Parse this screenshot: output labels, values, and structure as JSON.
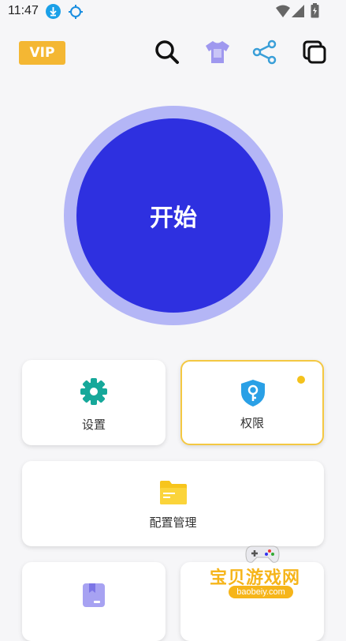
{
  "status_bar": {
    "time": "11:47"
  },
  "header": {
    "vip_label": "VIP",
    "icons": [
      "search-icon",
      "shirt-icon",
      "share-icon",
      "copy-icon"
    ]
  },
  "start": {
    "label": "开始",
    "accent": "#2e30e0",
    "ring": "#b4b6f6"
  },
  "cards": {
    "settings": {
      "label": "设置",
      "icon": "gear-icon",
      "color": "#16a89a"
    },
    "permission": {
      "label": "权限",
      "icon": "key-shield-icon",
      "color": "#2aa0e6",
      "badge": true
    },
    "config": {
      "label": "配置管理",
      "icon": "folder-icon",
      "color": "#f7c51c"
    },
    "bottom_left": {
      "icon": "bookmark-file-icon",
      "color": "#a7a2f2"
    }
  },
  "watermark": {
    "text": "宝贝游戏网",
    "url": "baobeiy.com"
  }
}
